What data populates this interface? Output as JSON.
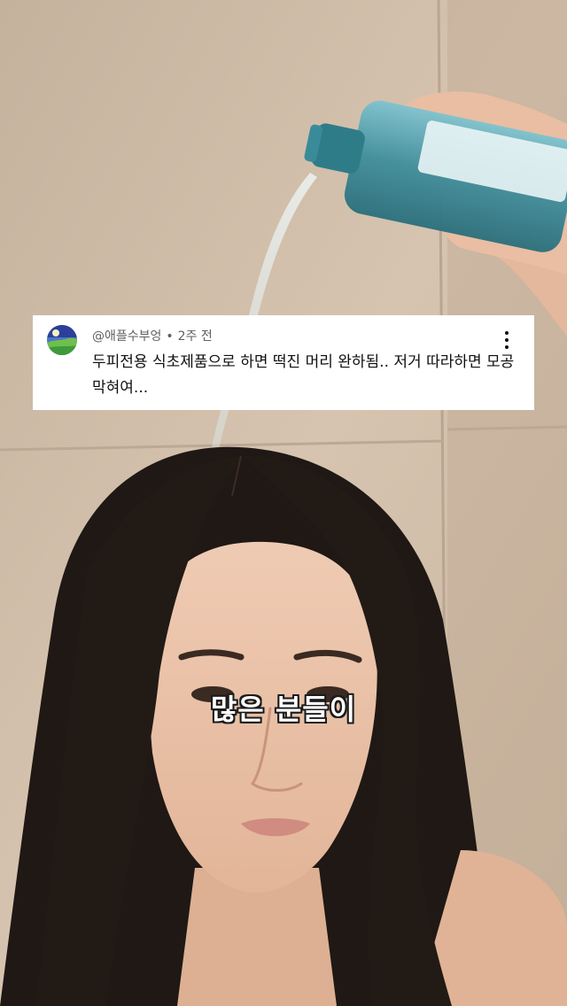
{
  "comment": {
    "author": "@애플수부엉",
    "separator": "•",
    "time_ago": "2주 전",
    "text": "두피전용 식초제품으로 하면 떡진 머리 완하됨.. 저거 따라하면 모공 막혀여...",
    "avatar_icon": "landscape-avatar-icon",
    "more_icon": "more-vert-icon"
  },
  "caption": {
    "text": "많은 분들이"
  },
  "colors": {
    "wall": "#cdb9a3",
    "hair": "#1f1814",
    "skin": "#e8c0a6",
    "bottle": "#3f8e9c",
    "comment_bg": "#ffffff",
    "caption_text": "#ffffff",
    "caption_outline": "#1a1a1a"
  }
}
